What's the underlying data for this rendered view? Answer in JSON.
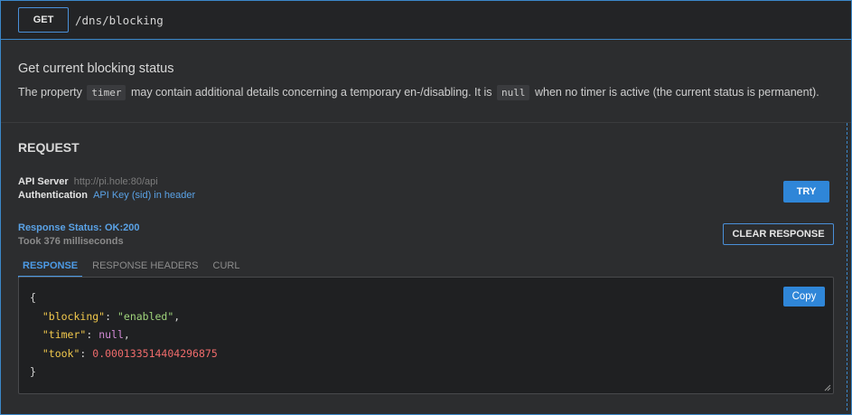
{
  "endpoint": {
    "method": "GET",
    "path": "/dns/blocking"
  },
  "description": {
    "title": "Get current blocking status",
    "text_part1": "The property",
    "code1": "timer",
    "text_part2": "may contain additional details concerning a temporary en-/disabling. It is",
    "code2": "null",
    "text_part3": "when no timer is active (the current status is permanent)."
  },
  "request": {
    "title": "REQUEST",
    "api_server_label": "API Server",
    "api_server_value": "http://pi.hole:80/api",
    "auth_label": "Authentication",
    "auth_value": "API Key (sid) in header",
    "try_label": "TRY",
    "clear_label": "CLEAR RESPONSE",
    "status_text": "Response Status: OK:200",
    "took_text": "Took 376 milliseconds",
    "tabs": [
      {
        "label": "RESPONSE",
        "active": true
      },
      {
        "label": "RESPONSE HEADERS",
        "active": false
      },
      {
        "label": "CURL",
        "active": false
      }
    ],
    "copy_label": "Copy"
  },
  "response_json": {
    "open_brace": "{",
    "close_brace": "}",
    "blocking_key": "\"blocking\"",
    "blocking_val": "\"enabled\"",
    "timer_key": "\"timer\"",
    "timer_val": "null",
    "took_key": "\"took\"",
    "took_val": "0.000133514404296875"
  },
  "colors": {
    "accent": "#2f86d8",
    "border_blue": "#3b87c9",
    "json_key": "#f2c94c",
    "json_string": "#9fd37a",
    "json_null": "#d28ad6",
    "json_number": "#ef6b6b"
  },
  "icons": {
    "resize": "resize-grip-icon"
  }
}
